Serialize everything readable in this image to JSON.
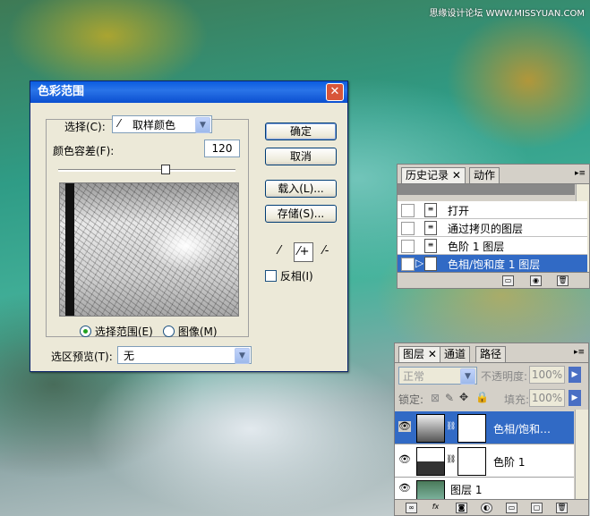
{
  "watermark": "思缘设计论坛 WWW.MISSYUAN.COM",
  "dialog": {
    "title": "色彩范围",
    "select_label": "选择(C):",
    "select_value": "取样颜色",
    "fuzziness_label": "颜色容差(F):",
    "fuzziness_value": "120",
    "fuzziness_fraction": 0.6,
    "radio_selection": "选择范围(E)",
    "radio_image": "图像(M)",
    "preview_label": "选区预览(T):",
    "preview_value": "无",
    "buttons": {
      "ok": "确定",
      "cancel": "取消",
      "load": "载入(L)...",
      "save": "存储(S)..."
    },
    "invert_label": "反相(I)",
    "close_glyph": "✕"
  },
  "history": {
    "tabs": [
      "历史记录",
      "动作"
    ],
    "tab_close": "✕",
    "items": [
      "打开",
      "通过拷贝的图层",
      "色阶 1 图层",
      "色相/饱和度 1 图层"
    ],
    "selected_index": 3,
    "menu_glyph": "▸≡"
  },
  "layers": {
    "tabs": [
      "图层",
      "通道",
      "路径"
    ],
    "tab_close": "✕",
    "blend_mode": "正常",
    "opacity_label": "不透明度:",
    "opacity_value": "100%",
    "lock_label": "锁定:",
    "fill_label": "填充:",
    "fill_value": "100%",
    "items": [
      {
        "name": "色相/饱和…",
        "type": "adjustment",
        "selected": true
      },
      {
        "name": "色阶 1",
        "type": "adjustment",
        "selected": false
      },
      {
        "name": "图层 1",
        "type": "image",
        "selected": false
      }
    ]
  },
  "colors": {
    "titlebar": "#0a5ce0",
    "selection": "#316ac5"
  }
}
